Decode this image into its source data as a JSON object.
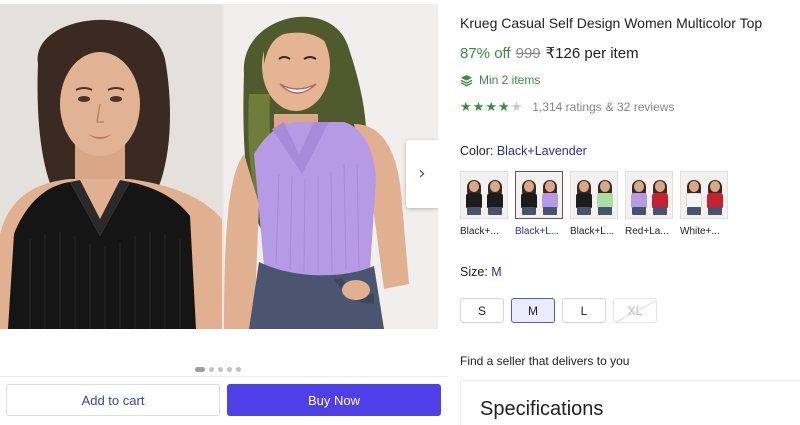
{
  "product": {
    "title": "Krueg Casual Self Design Women Multicolor Top",
    "discount": "87% off",
    "mrp": "999",
    "price": "₹126 per item",
    "min_qty": "Min 2 items",
    "rating_stars": 4,
    "ratings_text": "1,314 ratings",
    "reviews_text": "& 32 reviews"
  },
  "gallery": {
    "next_icon": "chevron-right-icon",
    "image_count": 5,
    "active_index": 0
  },
  "color": {
    "label": "Color:",
    "selected": "Black+Lavender",
    "options": [
      {
        "name": "Black+...",
        "top_colors": [
          "#1c1c1c",
          "#1c1c1c"
        ],
        "selected": false
      },
      {
        "name": "Black+L...",
        "top_colors": [
          "#1c1c1c",
          "#b69ae6"
        ],
        "selected": true
      },
      {
        "name": "Black+L...",
        "top_colors": [
          "#1c1c1c",
          "#a8e0a0"
        ],
        "selected": false
      },
      {
        "name": "Red+La...",
        "top_colors": [
          "#b69ae6",
          "#c8202e"
        ],
        "selected": false
      },
      {
        "name": "White+...",
        "top_colors": [
          "#f5f5f5",
          "#c8202e"
        ],
        "selected": false
      }
    ]
  },
  "size": {
    "label": "Size:",
    "selected": "M",
    "options": [
      {
        "label": "S",
        "state": "available"
      },
      {
        "label": "M",
        "state": "selected"
      },
      {
        "label": "L",
        "state": "available"
      },
      {
        "label": "XL",
        "state": "disabled"
      }
    ]
  },
  "actions": {
    "add_to_cart": "Add to cart",
    "buy_now": "Buy Now"
  },
  "seller": {
    "text": "Find a seller that delivers to you"
  },
  "specs": {
    "title": "Specifications"
  },
  "colors": {
    "accent": "#4f3fe6",
    "link": "#2a2ab5",
    "discount_green": "#388e3c"
  }
}
